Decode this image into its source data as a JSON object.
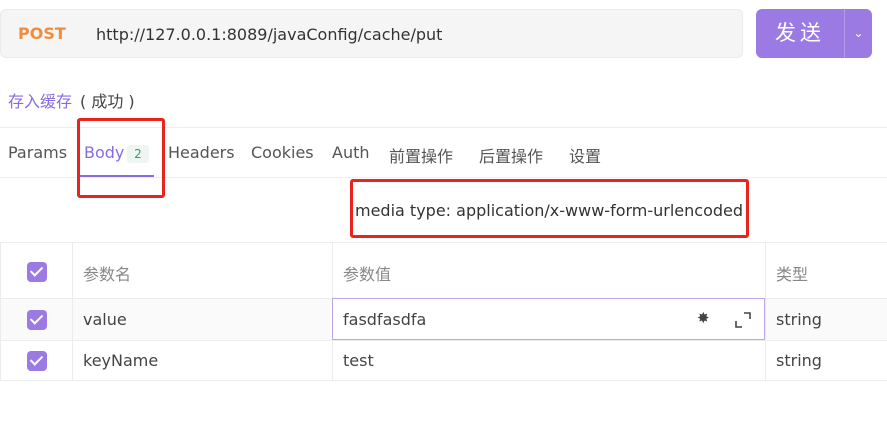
{
  "request": {
    "method": "POST",
    "url": "http://127.0.0.1:8089/javaConfig/cache/put",
    "send_label": "发送",
    "send_dropdown_icon": "chevron-down-icon"
  },
  "api": {
    "name": "存入缓存",
    "status": "( 成功 )"
  },
  "tabs": [
    {
      "label": "Params"
    },
    {
      "label": "Body",
      "badge": "2"
    },
    {
      "label": "Headers"
    },
    {
      "label": "Cookies"
    },
    {
      "label": "Auth"
    },
    {
      "label": "前置操作"
    },
    {
      "label": "后置操作"
    },
    {
      "label": "设置"
    }
  ],
  "active_tab": "Body",
  "body": {
    "media_type": "media type: application/x-www-form-urlencoded"
  },
  "table": {
    "headers": [
      "参数名",
      "参数值",
      "类型"
    ],
    "rows": [
      {
        "checked": true,
        "name": "value",
        "value": "fasdfasdfa",
        "type": "string"
      },
      {
        "checked": true,
        "name": "keyName",
        "value": "test",
        "type": "string"
      }
    ]
  },
  "colors": {
    "accent": "#9b7be3",
    "method": "#f08c3c",
    "highlight_box": "#e8241c"
  }
}
